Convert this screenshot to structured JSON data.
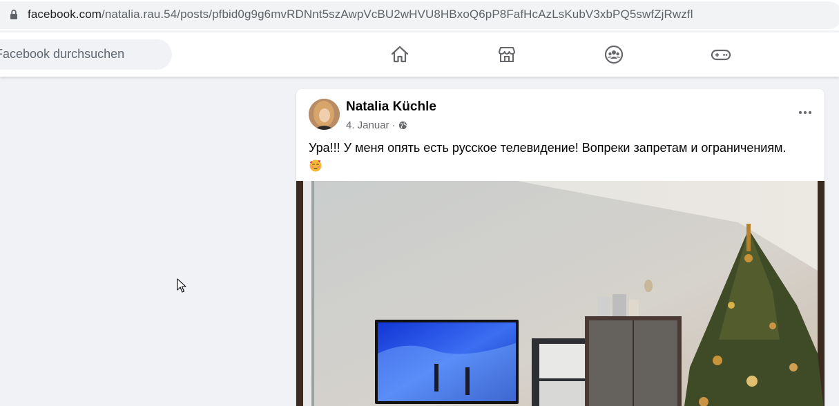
{
  "browser": {
    "url_host": "facebook.com",
    "url_path": "/natalia.rau.54/posts/pfbid0g9g6mvRDNnt5szAwpVcBU2wHVU8HBxoQ6pP8FafHcAzLsKubV3xbPQ5swfZjRwzfl"
  },
  "header": {
    "search_placeholder": "Facebook durchsuchen",
    "nav": [
      "home-icon",
      "marketplace-icon",
      "groups-icon",
      "gaming-icon"
    ]
  },
  "post": {
    "author": "Natalia Küchle",
    "date": "4. Januar",
    "separator": "·",
    "privacy_icon": "globe-icon",
    "text": "Ура!!! У меня опять есть русское телевидение! Вопреки запретам и ограничениям.",
    "emoji": "smiling-face-with-hearts"
  },
  "colors": {
    "background": "#f0f2f5",
    "card": "#ffffff",
    "text_primary": "#050505",
    "text_secondary": "#65676b"
  }
}
